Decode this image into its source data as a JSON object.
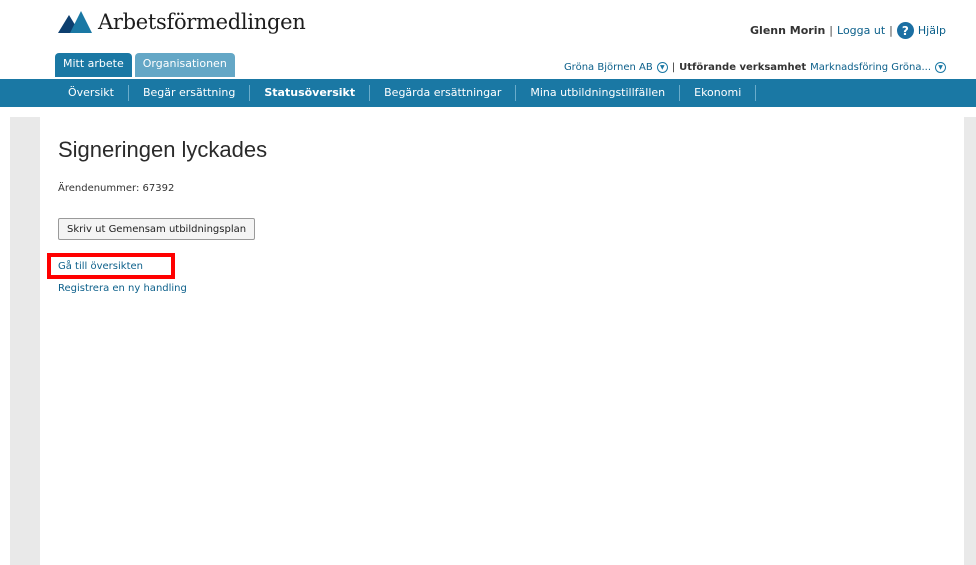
{
  "header": {
    "brand": "Arbetsförmedlingen",
    "user_name": "Glenn Morin",
    "separator": "|",
    "logout": "Logga ut",
    "help": "Hjälp",
    "help_icon_glyph": "?"
  },
  "tabs": [
    {
      "label": "Mitt arbete",
      "active": true
    },
    {
      "label": "Organisationen",
      "active": false
    }
  ],
  "org_bar": {
    "company": "Gröna Björnen AB",
    "separator": "|",
    "activity_label": "Utförande verksamhet",
    "activity_value": "Marknadsföring Gröna..."
  },
  "nav": [
    {
      "label": "Översikt"
    },
    {
      "label": "Begär ersättning"
    },
    {
      "label": "Statusöversikt"
    },
    {
      "label": "Begärda ersättningar"
    },
    {
      "label": "Mina utbildningstillfällen"
    },
    {
      "label": "Ekonomi"
    }
  ],
  "main": {
    "title": "Signeringen lyckades",
    "case_number": "Ärendenummer: 67392",
    "print_button": "Skriv ut Gemensam utbildningsplan",
    "link_overview": "Gå till översikten",
    "link_register": "Registrera en ny handling"
  },
  "colors": {
    "brand_blue": "#1a78a4",
    "link": "#0b5f8a",
    "highlight": "#ff0000"
  }
}
